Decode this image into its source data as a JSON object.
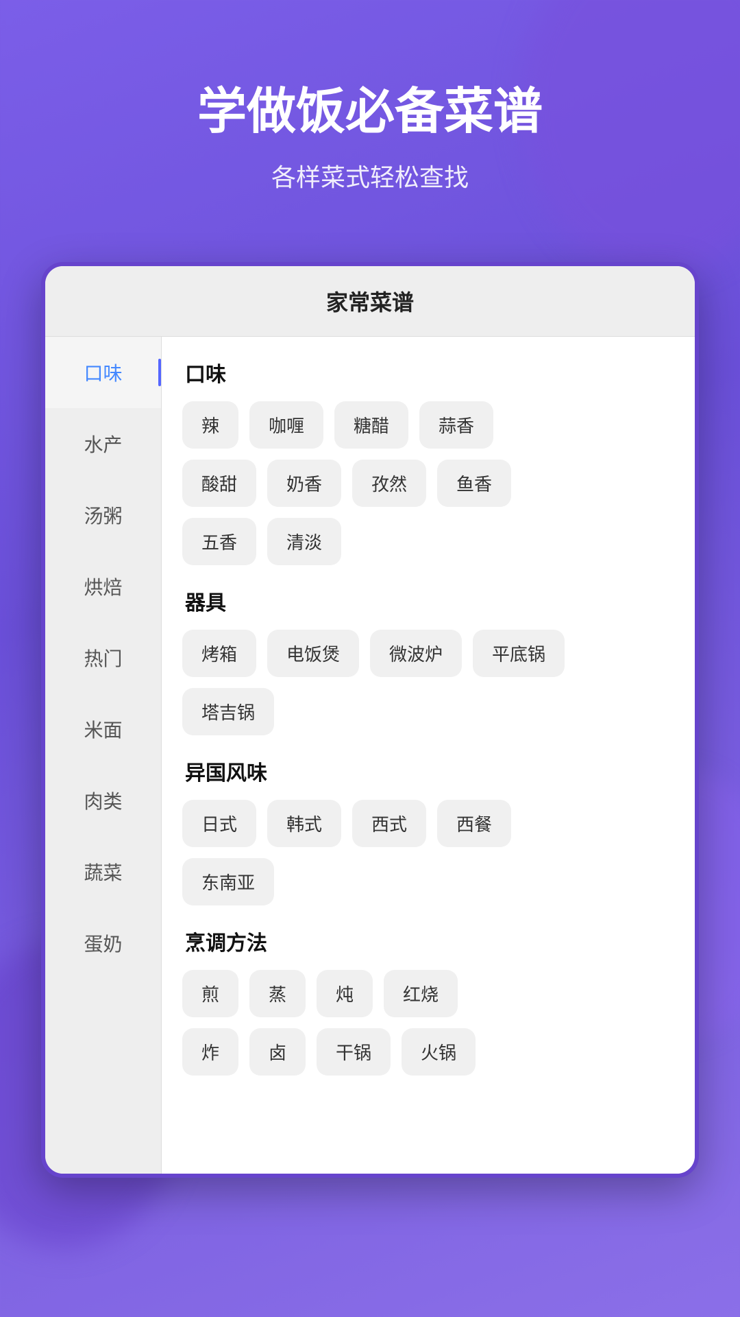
{
  "header": {
    "title": "学做饭必备菜谱",
    "subtitle": "各样菜式轻松查找"
  },
  "card": {
    "title": "家常菜谱"
  },
  "sidebar": {
    "items": [
      {
        "id": "kouwei",
        "label": "口味",
        "active": true
      },
      {
        "id": "shuichan",
        "label": "水产",
        "active": false
      },
      {
        "id": "tangzhou",
        "label": "汤粥",
        "active": false
      },
      {
        "id": "hongbei",
        "label": "烘焙",
        "active": false
      },
      {
        "id": "remen",
        "label": "热门",
        "active": false
      },
      {
        "id": "mimian",
        "label": "米面",
        "active": false
      },
      {
        "id": "roulei",
        "label": "肉类",
        "active": false
      },
      {
        "id": "shucai",
        "label": "蔬菜",
        "active": false
      },
      {
        "id": "dannai",
        "label": "蛋奶",
        "active": false
      }
    ]
  },
  "sections": [
    {
      "id": "kouwei",
      "title": "口味",
      "tags": [
        "辣",
        "咖喱",
        "糖醋",
        "蒜香",
        "酸甜",
        "奶香",
        "孜然",
        "鱼香",
        "五香",
        "清淡"
      ]
    },
    {
      "id": "qiju",
      "title": "器具",
      "tags": [
        "烤箱",
        "电饭煲",
        "微波炉",
        "平底锅",
        "塔吉锅"
      ]
    },
    {
      "id": "yiguofengwei",
      "title": "异国风味",
      "tags": [
        "日式",
        "韩式",
        "西式",
        "西餐",
        "东南亚"
      ]
    },
    {
      "id": "pengtiao",
      "title": "烹调方法",
      "tags": [
        "煎",
        "蒸",
        "炖",
        "红烧",
        "炸",
        "卤",
        "干锅",
        "火锅"
      ]
    }
  ]
}
